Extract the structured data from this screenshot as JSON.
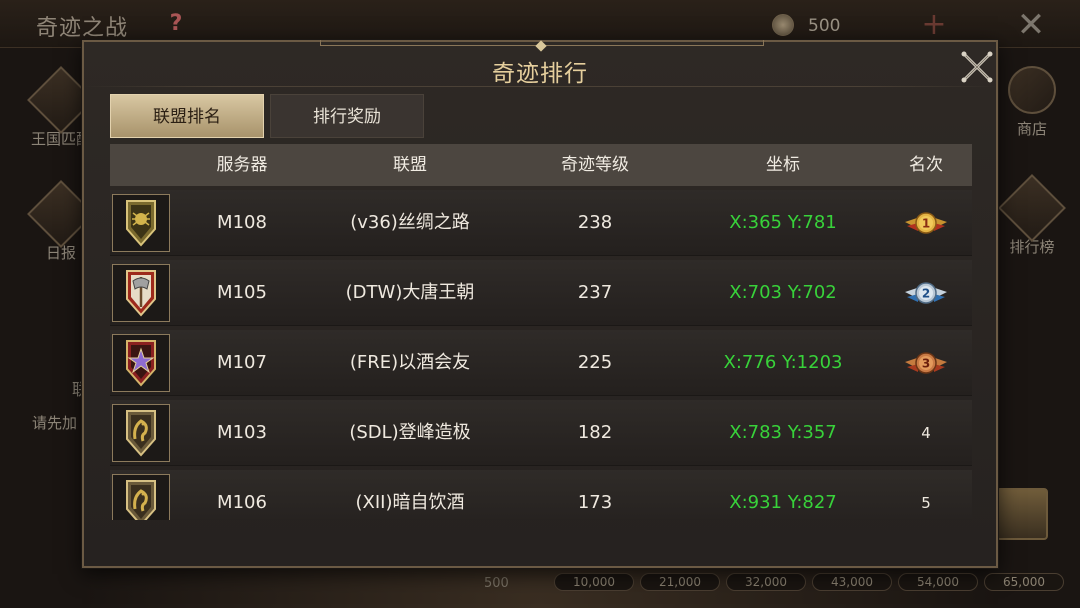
{
  "background": {
    "title": "奇迹之战",
    "help": "?",
    "coin_value": "500",
    "close": "✕",
    "side_left": [
      "王国匹配",
      "日报"
    ],
    "side_right": [
      "商店",
      "排行榜"
    ],
    "partial_text_1": "联",
    "partial_text_2": "请先加",
    "bottom_value": "500",
    "milestones": [
      "10,000",
      "21,000",
      "32,000",
      "43,000",
      "54,000",
      "65,000"
    ]
  },
  "modal": {
    "title": "奇迹排行",
    "tabs": [
      {
        "label": "联盟排名",
        "active": true
      },
      {
        "label": "排行奖励",
        "active": false
      }
    ],
    "columns": [
      "服务器",
      "联盟",
      "奇迹等级",
      "坐标",
      "名次"
    ],
    "rows": [
      {
        "banner_icon": "spider-crest-icon",
        "server": "M108",
        "alliance": "(v36)丝绸之路",
        "level": "238",
        "coord": "X:365 Y:781",
        "rank": "1",
        "medal": "gold-medal-icon"
      },
      {
        "banner_icon": "axe-crest-icon",
        "server": "M105",
        "alliance": "(DTW)大唐王朝",
        "level": "237",
        "coord": "X:703 Y:702",
        "rank": "2",
        "medal": "silver-medal-icon"
      },
      {
        "banner_icon": "star-crest-icon",
        "server": "M107",
        "alliance": "(FRE)以酒会友",
        "level": "225",
        "coord": "X:776 Y:1203",
        "rank": "3",
        "medal": "bronze-medal-icon"
      },
      {
        "banner_icon": "dragon-crest-icon",
        "server": "M103",
        "alliance": "(SDL)登峰造极",
        "level": "182",
        "coord": "X:783 Y:357",
        "rank": "4",
        "medal": ""
      },
      {
        "banner_icon": "dragon-crest-icon",
        "server": "M106",
        "alliance": "(XII)暗自饮酒",
        "level": "173",
        "coord": "X:931 Y:827",
        "rank": "5",
        "medal": ""
      }
    ]
  },
  "colors": {
    "coord_green": "#38d23a",
    "title_gold": "#e6cf9d",
    "tab_active_bg": "#c9b58d"
  }
}
